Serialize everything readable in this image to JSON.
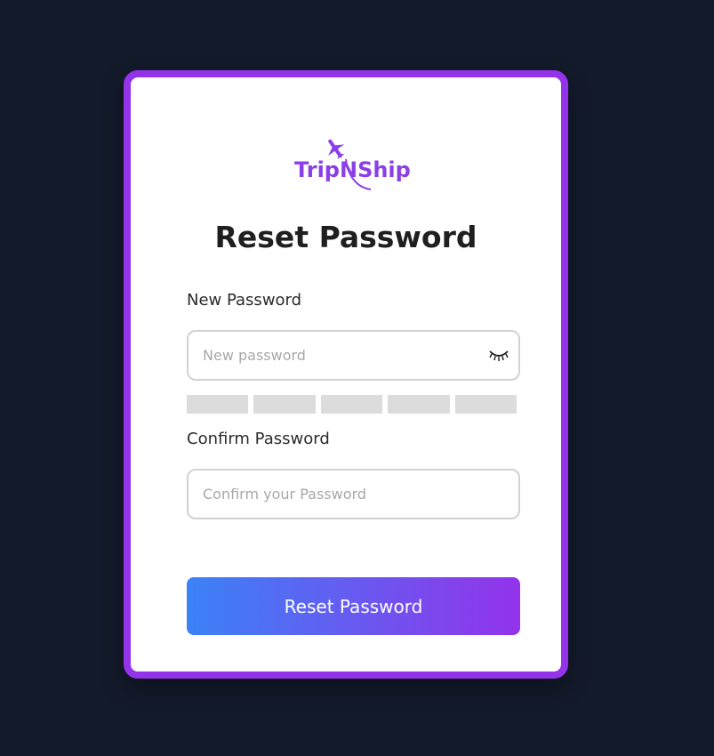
{
  "brand": {
    "logo_text": "TripNShip",
    "logo_icon": "airplane-icon",
    "accent_color": "#9333ea",
    "background_color": "#131a2a"
  },
  "page": {
    "title": "Reset Password"
  },
  "new_password": {
    "label": "New Password",
    "placeholder": "New password",
    "value": "",
    "toggle_icon": "eye-closed-icon",
    "strength_segments": 5,
    "strength_filled": 0
  },
  "confirm_password": {
    "label": "Confirm Password",
    "placeholder": "Confirm your Password",
    "value": ""
  },
  "submit": {
    "label": "Reset Password",
    "gradient_start": "#3b82f6",
    "gradient_end": "#9333ea"
  }
}
